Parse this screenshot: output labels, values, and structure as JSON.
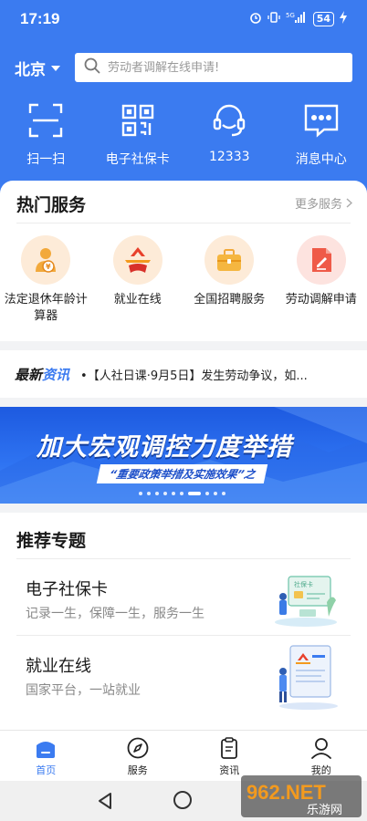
{
  "status": {
    "time": "17:19",
    "battery": "54"
  },
  "header": {
    "city": "北京",
    "search_placeholder": "劳动者调解在线申请!",
    "quick": [
      {
        "label": "扫一扫",
        "icon": "scan-icon"
      },
      {
        "label": "电子社保卡",
        "icon": "qr-code-icon"
      },
      {
        "label": "12333",
        "icon": "headset-icon"
      },
      {
        "label": "消息中心",
        "icon": "message-icon"
      }
    ]
  },
  "hot": {
    "title": "热门服务",
    "more": "更多服务",
    "items": [
      {
        "label": "法定退休年龄计算器",
        "icon": "retirement-calculator-icon"
      },
      {
        "label": "就业在线",
        "icon": "employment-logo-icon"
      },
      {
        "label": "全国招聘服务",
        "icon": "briefcase-icon"
      },
      {
        "label": "劳动调解申请",
        "icon": "document-edit-icon"
      }
    ]
  },
  "news": {
    "logo_main": "最新",
    "logo_accent": "资讯",
    "headline": "•【人社日课·9月5日】发生劳动争议，如..."
  },
  "banner": {
    "title": "加大宏观调控力度举措",
    "subtitle": "“重要政策举措及实施效果”之",
    "dot_count": 10,
    "active_dot": 6
  },
  "recommended": {
    "title": "推荐专题",
    "items": [
      {
        "name": "电子社保卡",
        "desc": "记录一生，保障一生，服务一生"
      },
      {
        "name": "就业在线",
        "desc": "国家平台，一站就业"
      }
    ]
  },
  "tabbar": {
    "items": [
      {
        "label": "首页",
        "icon": "home-icon",
        "active": true
      },
      {
        "label": "服务",
        "icon": "compass-icon",
        "active": false
      },
      {
        "label": "资讯",
        "icon": "clipboard-icon",
        "active": false
      },
      {
        "label": "我的",
        "icon": "user-icon",
        "active": false
      }
    ]
  },
  "watermark": {
    "text": "962.NET",
    "sub": "乐游网"
  },
  "colors": {
    "primary": "#3b7bf0",
    "orange_bg": "#fdebd8"
  }
}
